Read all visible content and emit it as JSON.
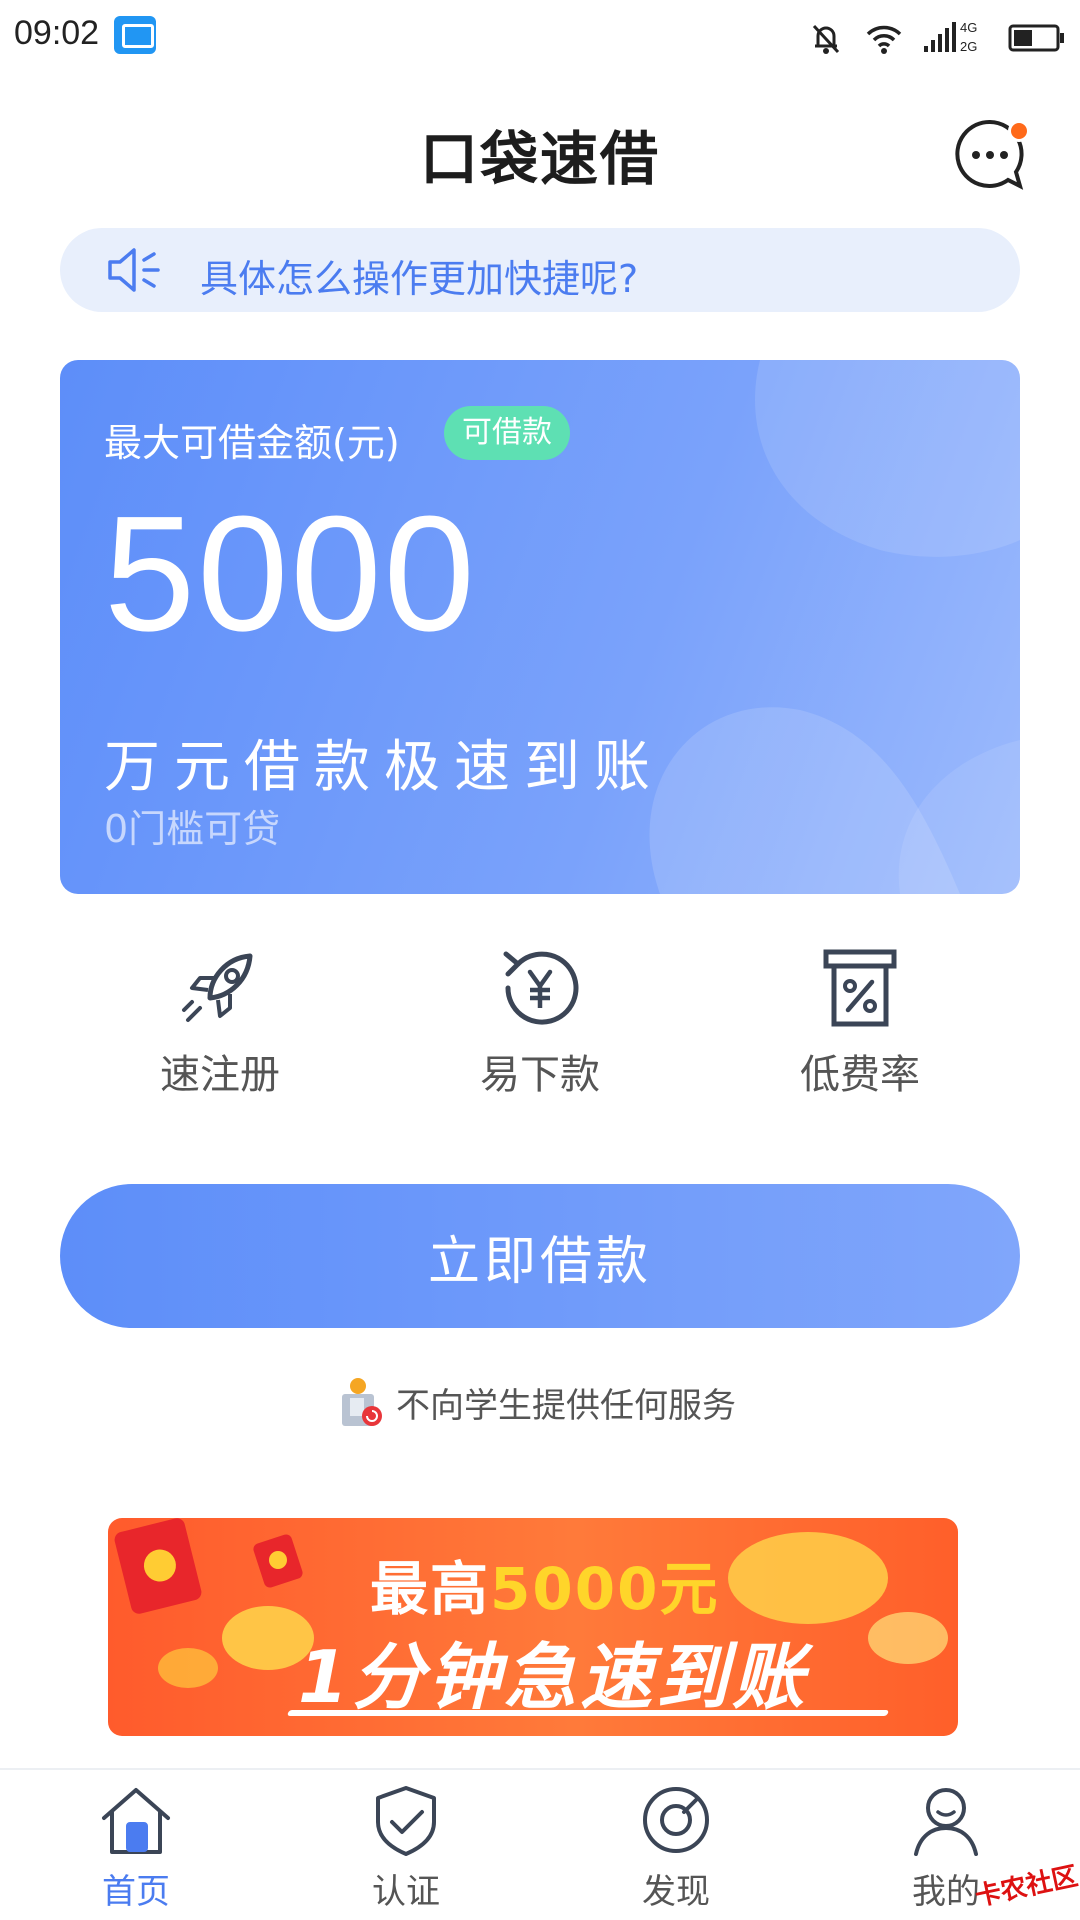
{
  "status_bar": {
    "time": "09:02",
    "network_1": "4G",
    "network_2": "2G"
  },
  "header": {
    "title": "口袋速借"
  },
  "notice": {
    "text": "具体怎么操作更加快捷呢?"
  },
  "loan_card": {
    "label": "最大可借金额(元)",
    "badge": "可借款",
    "amount": "5000",
    "slogan": "万元借款极速到账",
    "sub": "0门槛可贷"
  },
  "features": [
    {
      "label": "速注册",
      "icon": "rocket-icon"
    },
    {
      "label": "易下款",
      "icon": "yuan-refresh-icon"
    },
    {
      "label": "低费率",
      "icon": "percent-receipt-icon"
    }
  ],
  "borrow_button": {
    "label": "立即借款"
  },
  "student_notice": {
    "text": "不向学生提供任何服务"
  },
  "banner": {
    "title_prefix": "最高",
    "title_highlight": "5000元",
    "subtitle": "1分钟急速到账"
  },
  "tab_bar": [
    {
      "label": "首页",
      "icon": "home-icon",
      "active": true
    },
    {
      "label": "认证",
      "icon": "shield-check-icon",
      "active": false
    },
    {
      "label": "发现",
      "icon": "compass-icon",
      "active": false
    },
    {
      "label": "我的",
      "icon": "user-icon",
      "active": false
    }
  ],
  "watermark": "卡农社区",
  "colors": {
    "primary": "#5d8ef9",
    "badge_green": "#5ee0b3",
    "notice_bg": "#e8effc",
    "accent_orange": "#ff6a1a",
    "banner_yellow": "#ffd52a"
  }
}
